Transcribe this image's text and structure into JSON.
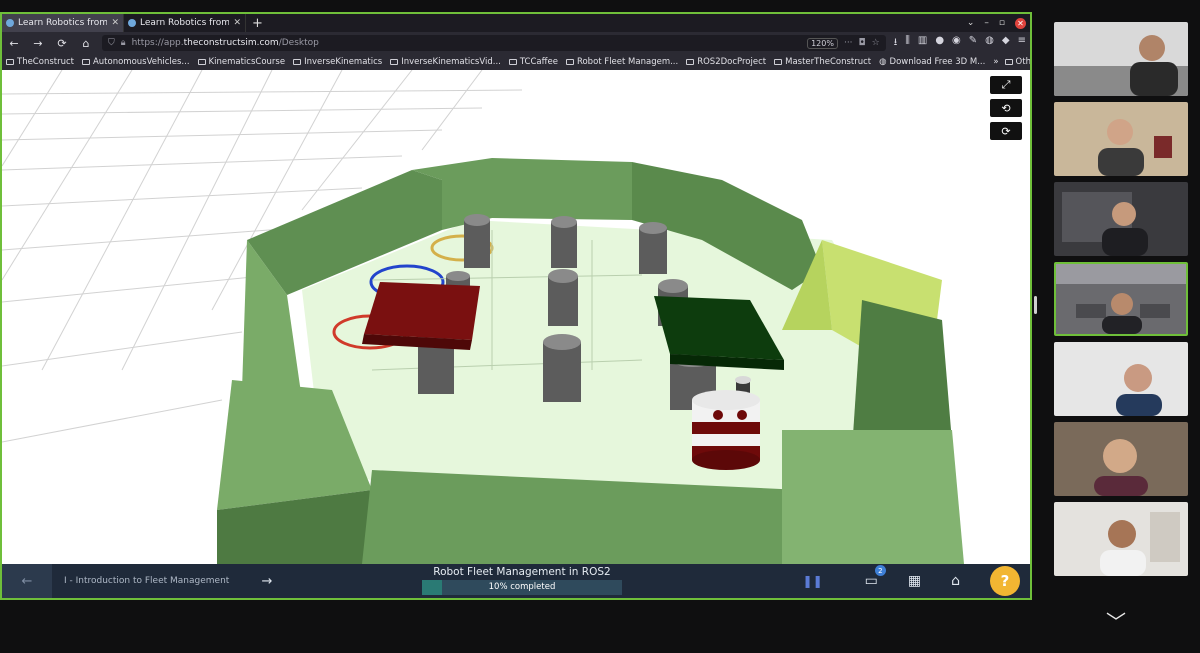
{
  "browser": {
    "tabs": [
      {
        "title": "Learn Robotics from Zer",
        "active": true
      },
      {
        "title": "Learn Robotics from Zer",
        "active": false
      }
    ],
    "new_tab": "+",
    "url_prefix": "https://app.",
    "url_host": "theconstructsim.com",
    "url_path": "/Desktop",
    "zoom": "120%",
    "bookmarks": [
      "TheConstruct",
      "AutonomousVehicles...",
      "KinematicsCourse",
      "InverseKinematics",
      "InverseKinematicsVid...",
      "TCCaffee",
      "Robot Fleet Managem...",
      "ROS2DocProject",
      "MasterTheConstruct",
      "Download Free 3D M..."
    ],
    "other_bookmarks": "Other Bookmarks"
  },
  "course": {
    "lesson": "I - Introduction to Fleet Management",
    "title": "Robot Fleet Management in ROS2",
    "progress_text": "10% completed",
    "progress": 0.1,
    "notification_count": "2",
    "help": "?"
  },
  "colors": {
    "accent_border": "#6fbf3a",
    "wall": "#6a9a59",
    "floor": "#e6f7dc",
    "red_table": "#7a1010",
    "green_table": "#0d3c0d",
    "progress": "#2a7a74",
    "help": "#f2b632"
  },
  "icons": {
    "expand": "expand-icon",
    "reset_view": "reset-view-icon",
    "refresh": "refresh-icon",
    "pause": "pause-icon",
    "screen": "screen-icon",
    "dashboard": "dashboard-icon",
    "home": "home-icon",
    "collapse": "chevron-down-icon"
  },
  "participants": 7
}
